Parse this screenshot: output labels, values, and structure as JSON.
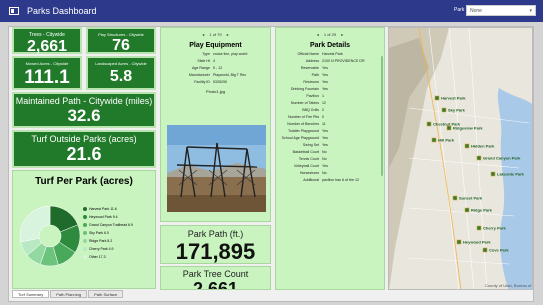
{
  "header": {
    "title": "Parks Dashboard",
    "park_label": "Park",
    "park_value": "None"
  },
  "tiles": {
    "trees": {
      "label": "Trees - Citywide",
      "value": "2,661"
    },
    "play": {
      "label": "Play Structures - Citywide",
      "value": "76"
    },
    "mowed": {
      "label": "Mowed Acres - Citywide",
      "value": "111.1"
    },
    "landscaped": {
      "label": "Landscaped Acres - Citywide",
      "value": "5.8"
    },
    "path": {
      "label": "Maintained Path - Citywide (miles)",
      "value": "32.6"
    },
    "turf": {
      "label": "Turf Outside Parks (acres)",
      "value": "21.6"
    }
  },
  "pie": {
    "title": "Turf Per Park (acres)",
    "chart_data": {
      "type": "pie",
      "title": "Turf Per Park (acres)",
      "labels": [
        "Harvest Park",
        "Heywood Park",
        "Grand Canyon Trailhead",
        "Sky Park",
        "Ridge Park",
        "Cherry Park",
        "Other"
      ],
      "values": [
        11.6,
        9.4,
        6.9,
        6.0,
        5.2,
        4.9,
        17.3
      ],
      "colors": [
        "#1f6b2b",
        "#2e8a3c",
        "#49a95a",
        "#6cc37c",
        "#93d8a0",
        "#b9e9c3",
        "#d8f4de"
      ]
    },
    "legend": [
      {
        "label": "Harvest Park",
        "value": "11.6",
        "color": "#1f6b2b"
      },
      {
        "label": "Heywood Park",
        "value": "9.4",
        "color": "#2e8a3c"
      },
      {
        "label": "Grand Canyon Trailhead",
        "value": "6.9",
        "color": "#49a95a"
      },
      {
        "label": "Sky Park",
        "value": "6.0",
        "color": "#6cc37c"
      },
      {
        "label": "Ridge Park",
        "value": "5.2",
        "color": "#93d8a0"
      },
      {
        "label": "Cherry Park",
        "value": "4.9",
        "color": "#b9e9c3"
      },
      {
        "label": "Other",
        "value": "17.3",
        "color": "#d8f4de"
      }
    ]
  },
  "tabs": [
    "Turf Summary",
    "Path Planning",
    "Path Surface"
  ],
  "equipment": {
    "pager": "1 of 79",
    "title": "Play Equipment",
    "fields": [
      {
        "k": "Type",
        "v": "cruise line, play world"
      },
      {
        "k": "Slide Ht",
        "v": "4"
      },
      {
        "k": "Age Range",
        "v": "5 - 12"
      },
      {
        "k": "Manufacturer",
        "v": "Playworld, Big T Rec"
      },
      {
        "k": "Facility ID",
        "v": "5335290"
      }
    ],
    "photo_label": "Photo1.jpg"
  },
  "stats": {
    "path": {
      "label": "Park Path (ft.)",
      "value": "171,895"
    },
    "trees": {
      "label": "Park Tree Count",
      "value": "2,661"
    }
  },
  "details": {
    "pager": "1 of 29",
    "title": "Park Details",
    "fields": [
      {
        "k": "Official Name",
        "v": "Harvest Park"
      },
      {
        "k": "Address",
        "v": "2100 N PROVIDENCE DR"
      },
      {
        "k": "Reservable",
        "v": "Yes"
      },
      {
        "k": "Path",
        "v": "Yes"
      },
      {
        "k": "Restroom",
        "v": "Yes"
      },
      {
        "k": "Drinking Fountain",
        "v": "Yes"
      },
      {
        "k": "Pavilion",
        "v": "1"
      },
      {
        "k": "Number of Tables",
        "v": "12"
      },
      {
        "k": "BBQ Grills",
        "v": "2"
      },
      {
        "k": "Number of Fire Pits",
        "v": "0"
      },
      {
        "k": "Number of Benches",
        "v": "11"
      },
      {
        "k": "Toddler Playground",
        "v": "Yes"
      },
      {
        "k": "School Age Playground",
        "v": "Yes"
      },
      {
        "k": "Swing Set",
        "v": "Yes"
      },
      {
        "k": "Basketball Court",
        "v": "No"
      },
      {
        "k": "Tennis Court",
        "v": "No"
      },
      {
        "k": "Volleyball Court",
        "v": "Yes"
      },
      {
        "k": "Horseshoes",
        "v": "No"
      },
      {
        "k": "Additional",
        "v": "pavilion has 6 of the 12"
      }
    ]
  },
  "map": {
    "attribution": "County of Utah, Bureau of",
    "labels": [
      "Harvest Park",
      "Sky Park",
      "Chestnut Park",
      "Ridgeview Park",
      "Hill Park",
      "Hidden Park",
      "Grand Canyon Park",
      "Lakeside Park",
      "Sunset Park",
      "Ridge Park",
      "Cherry Park",
      "Heywood Park",
      "Cove Park"
    ]
  }
}
